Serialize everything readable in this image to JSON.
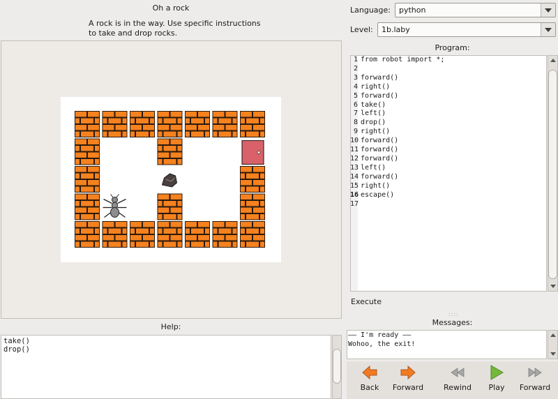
{
  "level_info": {
    "title": "Oh a rock",
    "description": "A rock is in the way. Use specific instructions to take and drop rocks."
  },
  "help": {
    "label": "Help:",
    "lines": [
      "take()",
      "drop()"
    ]
  },
  "settings": {
    "language_label": "Language:",
    "language_value": "python",
    "level_label": "Level:",
    "level_value": "1b.laby"
  },
  "program": {
    "label": "Program:",
    "current_line": 16,
    "lines": [
      "from robot import *;",
      "",
      "forward()",
      "right()",
      "forward()",
      "take()",
      "left()",
      "drop()",
      "right()",
      "forward()",
      "forward()",
      "forward()",
      "left()",
      "forward()",
      "right()",
      "escape()",
      ""
    ]
  },
  "execute_label": "Execute",
  "messages": {
    "label": "Messages:",
    "lines": [
      "—— I'm ready ——",
      "Wohoo, the exit!"
    ]
  },
  "controls": {
    "back_label": "Back",
    "forward_label": "Forward",
    "rewind_label": "Rewind",
    "play_label": "Play",
    "step_forward_label": "Forward"
  },
  "colors": {
    "brick_fill": "#f5821f",
    "brick_stroke": "#2b1a0e",
    "door": "#d9626a",
    "play": "#76b83a",
    "nav_arrow": "#f07b22"
  },
  "icons": {
    "ant": "ant-icon",
    "rock": "rock-icon",
    "exit_door": "exit-door-icon"
  }
}
